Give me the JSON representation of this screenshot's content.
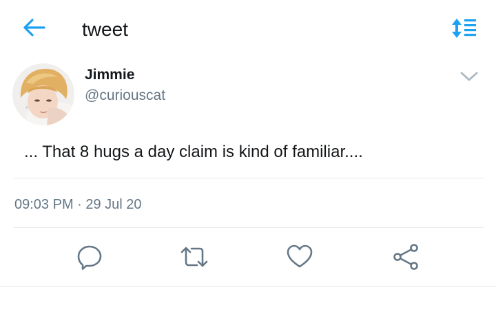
{
  "colors": {
    "accent": "#1da1f2",
    "text": "#14171a",
    "muted": "#657786",
    "divider": "#e1e8ed",
    "icon": "#657786"
  },
  "header": {
    "back_icon": "arrow-left-icon",
    "title": "tweet",
    "sort_icon": "sort-list-icon"
  },
  "tweet": {
    "author": {
      "name": "Jimmie",
      "handle": "@curiouscat",
      "avatar": "avatar-photo"
    },
    "menu_icon": "chevron-down-icon",
    "text": "... That 8 hugs a day claim is kind of familiar....",
    "timestamp": "09:03 PM · 29 Jul 20"
  },
  "actions": [
    {
      "name": "reply",
      "icon": "reply-icon"
    },
    {
      "name": "retweet",
      "icon": "retweet-icon"
    },
    {
      "name": "like",
      "icon": "heart-icon"
    },
    {
      "name": "share",
      "icon": "share-icon"
    }
  ]
}
